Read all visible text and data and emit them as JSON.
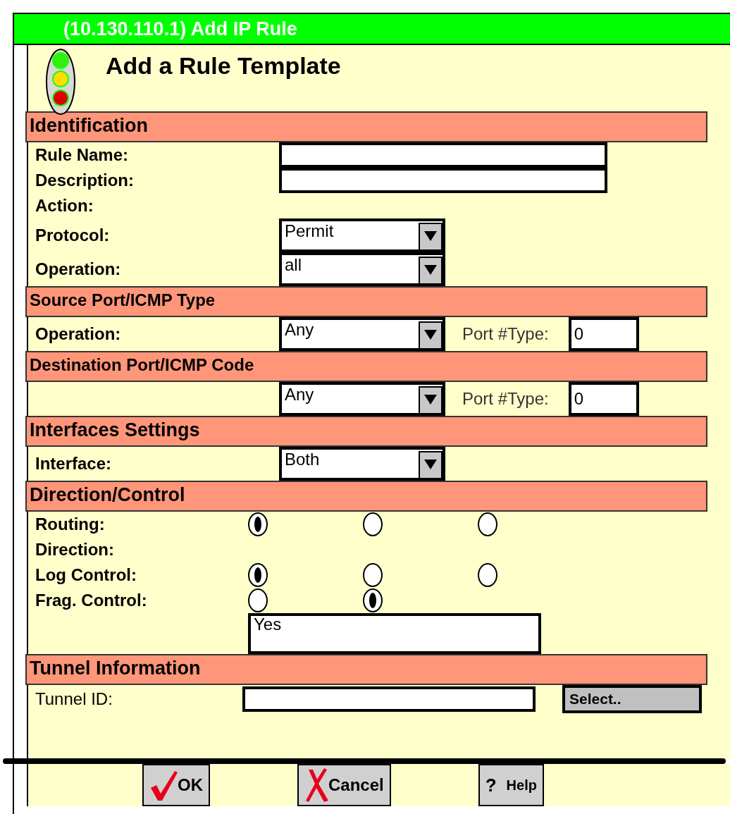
{
  "window": {
    "title": "(10.130.110.1) Add IP Rule"
  },
  "heading": "Add a Rule Template",
  "sections": [
    {
      "title": "Identification",
      "rows": [
        {
          "label": "Rule Name:",
          "controls": [
            {
              "kind": "text"
            }
          ]
        },
        {
          "label": "Description:",
          "controls": [
            {
              "kind": "text"
            }
          ]
        },
        {
          "label": "Action:",
          "controls": []
        },
        {
          "label": "Protocol:",
          "controls": [
            {
              "kind": "dropdown",
              "value": "Permit"
            }
          ]
        },
        {
          "label": "Operation:",
          "controls": [
            {
              "kind": "dropdown",
              "value": "all"
            }
          ]
        }
      ]
    },
    {
      "title": "Source Port/ICMP Type",
      "rows": [
        {
          "label": "Operation:",
          "controls": [
            {
              "kind": "dropdown",
              "value": "Any"
            },
            {
              "kind": "caption",
              "text": "Port #Type:"
            },
            {
              "kind": "text",
              "value": "0"
            }
          ]
        }
      ]
    },
    {
      "title": "Destination Port/ICMP Code",
      "rows": [
        {
          "controls": [
            {
              "kind": "dropdown",
              "value": "Any"
            },
            {
              "kind": "caption",
              "text": "Port #Type:"
            },
            {
              "kind": "text",
              "value": "0"
            }
          ]
        }
      ]
    },
    {
      "title": "Interfaces Settings",
      "rows": [
        {
          "label": "Interface:",
          "controls": [
            {
              "kind": "dropdown",
              "value": "Both"
            }
          ]
        }
      ]
    },
    {
      "title": "Direction/Control",
      "rows": [
        {
          "label": "Routing:",
          "controls": [
            {
              "kind": "radio",
              "selected": true
            },
            {
              "kind": "radio",
              "selected": false
            },
            {
              "kind": "radio",
              "selected": false
            }
          ]
        },
        {
          "label": "Direction:",
          "controls": []
        },
        {
          "label": "Log Control:",
          "controls": [
            {
              "kind": "radio",
              "selected": true
            },
            {
              "kind": "radio",
              "selected": false
            },
            {
              "kind": "radio",
              "selected": false
            }
          ]
        },
        {
          "label": "Frag. Control:",
          "controls": [
            {
              "kind": "radio",
              "selected": false
            },
            {
              "kind": "radio",
              "selected": true
            }
          ]
        },
        {
          "controls": [
            {
              "kind": "text",
              "value": "Yes"
            }
          ]
        }
      ]
    },
    {
      "title": "Tunnel Information",
      "rows": [
        {
          "label": "Tunnel ID:",
          "controls": [
            {
              "kind": "text"
            },
            {
              "kind": "button",
              "text": "Select.."
            }
          ]
        }
      ]
    }
  ],
  "buttons": [
    {
      "kind": "ok",
      "label": "OK"
    },
    {
      "kind": "cancel",
      "label": "Cancel"
    },
    {
      "kind": "help",
      "mark": "?",
      "label": "Help"
    }
  ]
}
